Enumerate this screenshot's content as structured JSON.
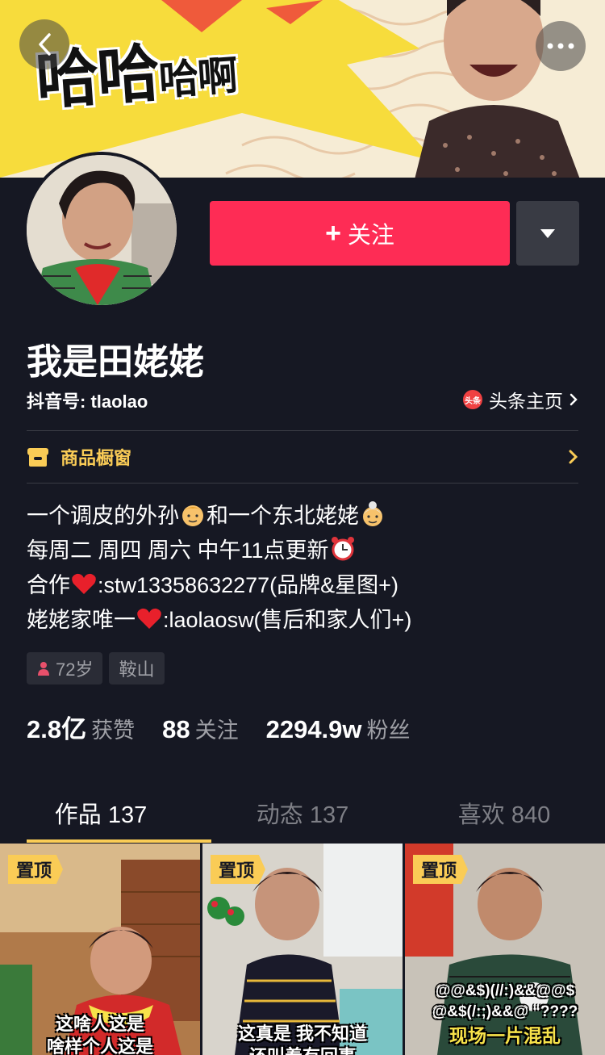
{
  "banner": {
    "text_big": "哈哈",
    "text_small1": "哈",
    "text_small2": "啊"
  },
  "header": {
    "back_label": "‹",
    "more_label": "•••"
  },
  "profile": {
    "name": "我是田姥姥",
    "douyin_id": "抖音号: tlaolao",
    "toutiao_label": "头条主页",
    "toutiao_logo": "头条",
    "follow_label": "关注",
    "follow_plus": "+"
  },
  "shop": {
    "label": "商品橱窗"
  },
  "bio": {
    "line1_a": "一个调皮的外孙",
    "line1_b": "和一个东北姥姥",
    "line2": "每周二 周四 周六 中午11点更新",
    "line3_a": "合作",
    "line3_b": ":stw13358632277(品牌&星图+)",
    "line4_a": "姥姥家唯一",
    "line4_b": ":laolaosw(售后和家人们+)"
  },
  "tags": {
    "age": "72岁",
    "location": "鞍山"
  },
  "stats": {
    "likes_num": "2.8亿",
    "likes_label": "获赞",
    "following_num": "88",
    "following_label": "关注",
    "followers_num": "2294.9w",
    "followers_label": "粉丝"
  },
  "tabs": [
    {
      "label": "作品 137"
    },
    {
      "label": "动态 137"
    },
    {
      "label": "喜欢 840"
    }
  ],
  "videos": [
    {
      "pin": "置顶",
      "caption_l1": "这啥人这是",
      "caption_l2": "啥样个人这是"
    },
    {
      "pin": "置顶",
      "caption_l1": "这真是 我不知道",
      "caption_l2": "还叫着有回事"
    },
    {
      "pin": "置顶",
      "caption_l1": "@@&$)(//:)&&@@$",
      "caption_l2": "@&$(/:;)&&@ “????",
      "caption_l3": "现场一片混乱"
    }
  ],
  "colors": {
    "accent": "#fe2c55",
    "gold": "#facc56",
    "bg": "#161823"
  }
}
